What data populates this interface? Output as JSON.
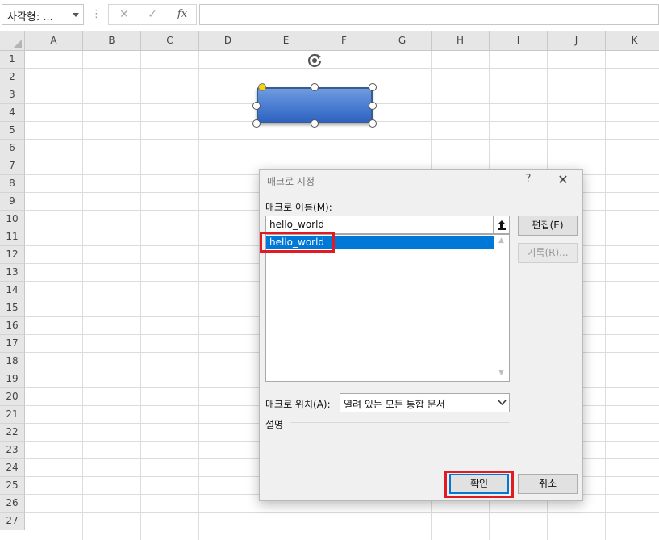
{
  "formula_bar": {
    "name_box": "사각형: ...",
    "separator_icon": "vertical-dots-icon",
    "cancel_icon": "✕",
    "enter_icon": "✓",
    "fx_label": "fx",
    "formula_value": ""
  },
  "grid": {
    "columns": [
      "A",
      "B",
      "C",
      "D",
      "E",
      "F",
      "G",
      "H",
      "I",
      "J",
      "K"
    ],
    "rows": [
      "1",
      "2",
      "3",
      "4",
      "5",
      "6",
      "7",
      "8",
      "9",
      "10",
      "11",
      "12",
      "13",
      "14",
      "15",
      "16",
      "17",
      "18",
      "19",
      "20",
      "21",
      "22",
      "23",
      "24",
      "25",
      "26",
      "27"
    ]
  },
  "shape": {
    "type": "rounded-rectangle",
    "fill_top": "#6f9be0",
    "fill_bottom": "#2f63c0",
    "border": "#385d8a",
    "selected": true
  },
  "dialog": {
    "title": "매크로 지정",
    "help": "?",
    "close": "✕",
    "macro_name_label": "매크로 이름(M):",
    "macro_name_value": "hello_world",
    "macro_list": [
      "hello_world"
    ],
    "selected_macro": "hello_world",
    "edit_button": "편집(E)",
    "record_button": "기록(R)...",
    "location_label": "매크로 위치(A):",
    "location_value": "열려 있는 모든 통합 문서",
    "description_label": "설명",
    "ok_button": "확인",
    "cancel_button": "취소"
  },
  "colors": {
    "selection": "#0078d7",
    "highlight": "#e01b24",
    "dialog_bg": "#f0f0f0"
  }
}
